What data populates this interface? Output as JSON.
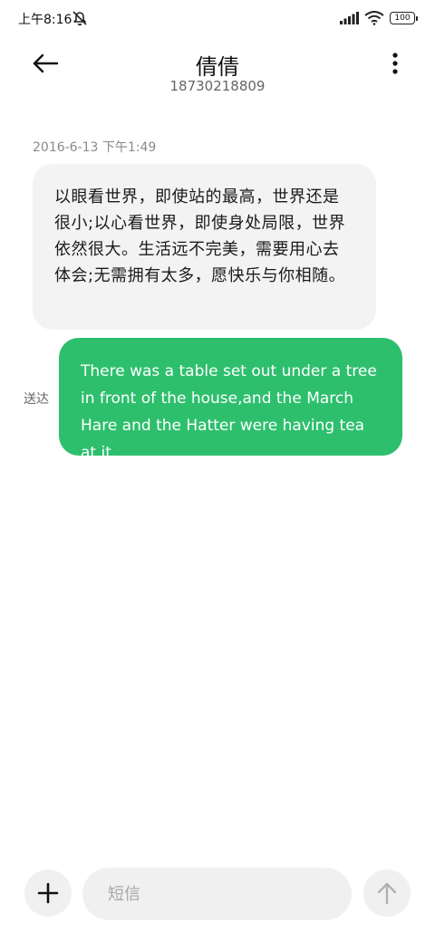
{
  "status_bar": {
    "time": "上午8:16",
    "battery": "100"
  },
  "header": {
    "contact_name": "倩倩",
    "contact_number": "18730218809"
  },
  "conversation": {
    "timestamp": "2016-6-13 下午1:49",
    "messages": [
      {
        "direction": "incoming",
        "text": "以眼看世界，即使站的最高，世界还是很小;以心看世界，即使身处局限，世界依然很大。生活远不完美，需要用心去体会;无需拥有太多，愿快乐与你相随。"
      },
      {
        "direction": "outgoing",
        "status": "送达",
        "text": "There was a table set out under a tree in front of the house,and the March Hare and the Hatter were having tea at it."
      }
    ]
  },
  "composer": {
    "placeholder": "短信",
    "value": ""
  },
  "colors": {
    "outgoing_bubble": "#2ebf6d",
    "incoming_bubble": "#f3f3f3",
    "background": "#ffffff"
  },
  "icons": {
    "back": "arrow-left-icon",
    "more": "more-vertical-icon",
    "add": "plus-icon",
    "send": "arrow-up-icon",
    "mute": "bell-off-icon",
    "signal": "signal-icon",
    "wifi": "wifi-icon",
    "battery": "battery-icon"
  }
}
